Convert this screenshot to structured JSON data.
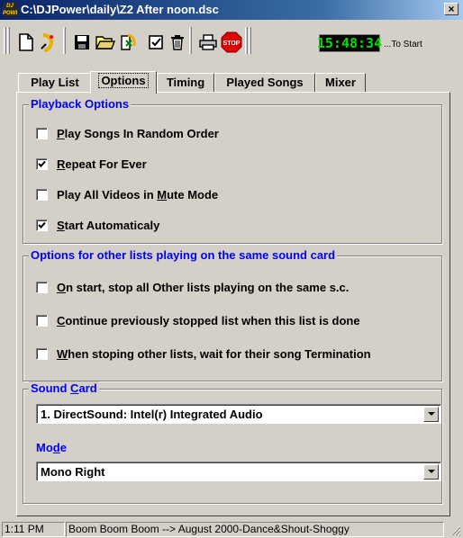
{
  "window": {
    "title": "C:\\DJPower\\daily\\Z2  After noon.dsc",
    "logo_text": "DJ POWER",
    "close_label": "×"
  },
  "toolbar": {
    "buttons": [
      {
        "name": "new-list-button",
        "icon": "new-document-icon"
      },
      {
        "name": "wizard-button",
        "icon": "wizard-icon"
      },
      {
        "name": "save-button",
        "icon": "floppy-disk-icon"
      },
      {
        "name": "open-button",
        "icon": "open-folder-icon"
      },
      {
        "name": "import-button",
        "icon": "import-icon"
      },
      {
        "name": "check-button",
        "icon": "checkmark-icon"
      },
      {
        "name": "delete-button",
        "icon": "trash-icon"
      },
      {
        "name": "print-button",
        "icon": "printer-icon"
      },
      {
        "name": "stop-button",
        "icon": "stop-sign-icon",
        "label": "STOP"
      }
    ],
    "clock": "15:48:34",
    "clock_suffix": "...To Start",
    "clock_color": "#00e000"
  },
  "tabs": [
    {
      "label": "Play List",
      "active": false
    },
    {
      "label": "Options",
      "active": true
    },
    {
      "label": "Timing",
      "active": false
    },
    {
      "label": "Played Songs",
      "active": false
    },
    {
      "label": "Mixer",
      "active": false
    }
  ],
  "playback": {
    "title": "Playback Options",
    "options": [
      {
        "pre": "",
        "key": "P",
        "post": "lay Songs In Random Order",
        "checked": false
      },
      {
        "pre": "",
        "key": "R",
        "post": "epeat For Ever",
        "checked": true
      },
      {
        "pre": "Play All Videos in ",
        "key": "M",
        "post": "ute Mode",
        "checked": false
      },
      {
        "pre": "",
        "key": "S",
        "post": "tart Automaticaly",
        "checked": true
      }
    ]
  },
  "other_lists": {
    "title": "Options for other lists playing on the same sound card",
    "options": [
      {
        "pre": "",
        "key": "O",
        "post": "n start, stop all Other lists playing on the same s.c.",
        "checked": false
      },
      {
        "pre": "",
        "key": "C",
        "post": "ontinue previously stopped list when this list is done",
        "checked": false
      },
      {
        "pre": "",
        "key": "W",
        "post": "hen stoping other lists, wait for their song Termination",
        "checked": false
      }
    ]
  },
  "sound": {
    "title_pre": "Sound ",
    "title_key": "C",
    "title_post": "ard",
    "card_value": "1. DirectSound: Intel(r) Integrated Audio",
    "mode_pre": "Mo",
    "mode_key": "d",
    "mode_post": "e",
    "mode_value": "Mono Right"
  },
  "status": {
    "time": "1:11 PM",
    "now_playing": "Boom Boom Boom -->  August 2000-Dance&Shout-Shoggy"
  },
  "colors": {
    "face": "#d4d0c8",
    "accent": "#0000ff",
    "titlebar": "#0a246a"
  }
}
